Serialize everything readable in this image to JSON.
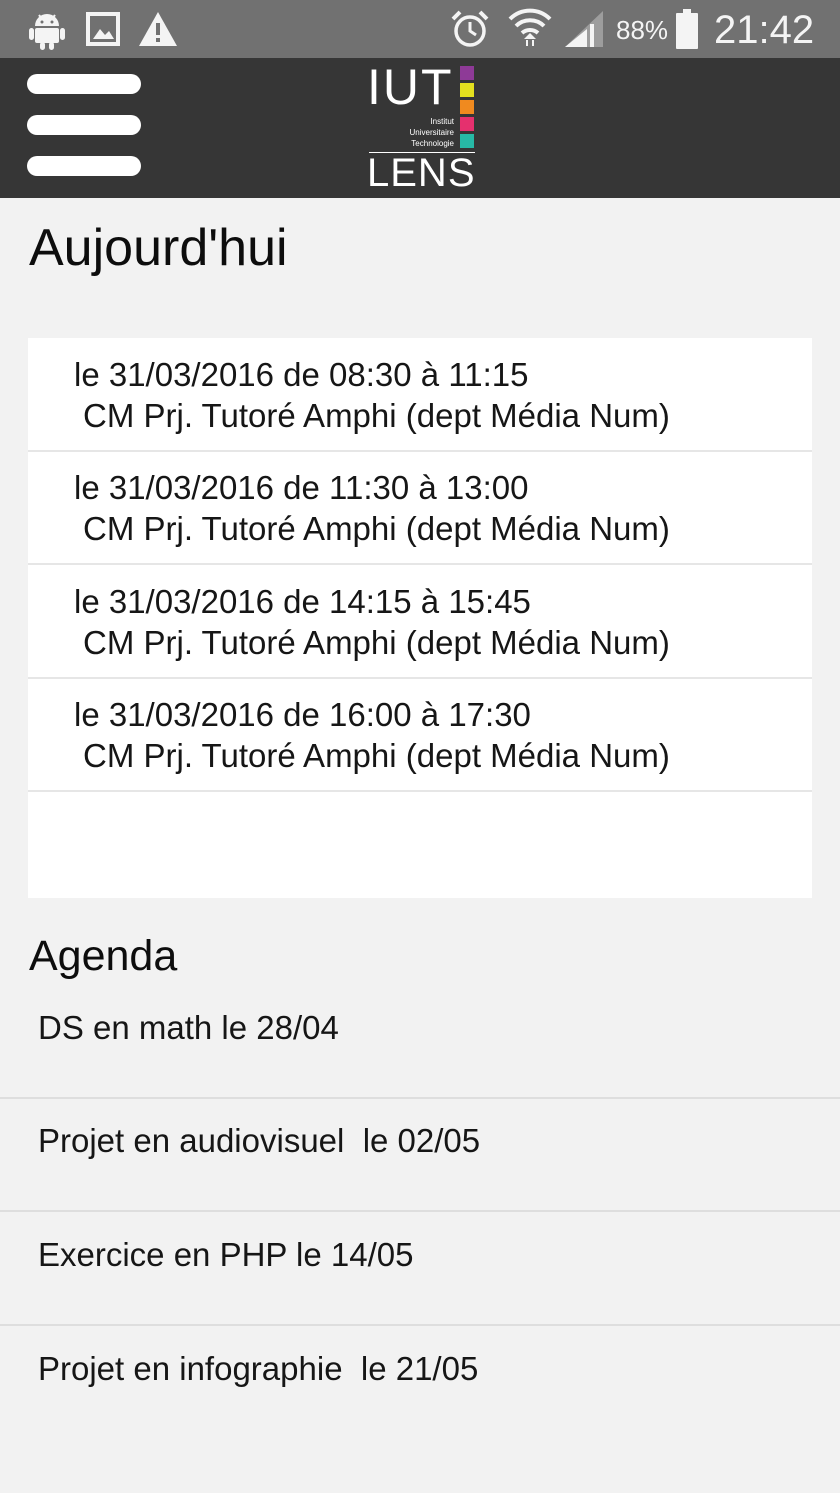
{
  "status_bar": {
    "battery": "88%",
    "time": "21:42"
  },
  "header": {
    "logo": {
      "main": "IUT",
      "line1": "Institut",
      "line2": "Universitaire",
      "line3": "Technologie",
      "city": "LENS",
      "colors": [
        "#8e3a97",
        "#e4e01f",
        "#f08a1f",
        "#e5306e",
        "#27b9a6"
      ]
    }
  },
  "today": {
    "title": "Aujourd'hui",
    "courses": [
      {
        "line1": "le 31/03/2016 de 08:30 à 11:15",
        "line2": "CM Prj. Tutoré Amphi (dept Média Num)"
      },
      {
        "line1": "le 31/03/2016 de 11:30 à 13:00",
        "line2": "CM Prj. Tutoré Amphi (dept Média Num)"
      },
      {
        "line1": "le 31/03/2016 de 14:15 à 15:45",
        "line2": "CM Prj. Tutoré Amphi (dept Média Num)"
      },
      {
        "line1": "le 31/03/2016 de 16:00 à 17:30",
        "line2": "CM Prj. Tutoré Amphi (dept Média Num)"
      }
    ]
  },
  "agenda": {
    "title": "Agenda",
    "items": [
      "DS en math le 28/04",
      "Projet en audiovisuel  le 02/05",
      "Exercice en PHP le 14/05",
      "Projet en infographie  le 21/05"
    ]
  },
  "colors": {
    "status_bar": "#717171",
    "app_bar": "#363636",
    "background": "#f2f2f2"
  }
}
